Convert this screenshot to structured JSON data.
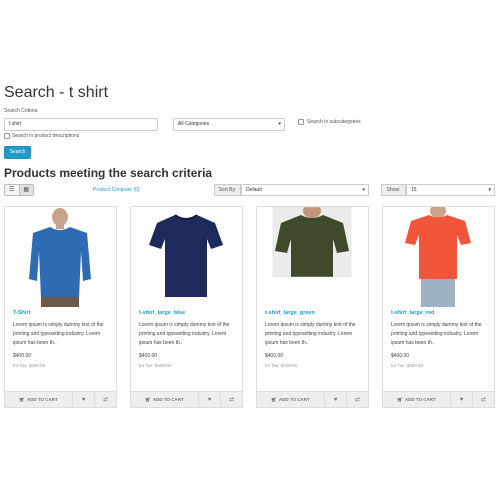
{
  "page": {
    "title": "Search - t shirt",
    "criteria_label": "Search Criteria"
  },
  "search": {
    "value": "t shirt",
    "category": "All Categories",
    "subcategories_label": "Search in subcategories",
    "descriptions_label": "Search in product descriptions",
    "button_label": "Search"
  },
  "results": {
    "heading": "Products meeting the search criteria",
    "compare_link": "Product Compare (0)",
    "sort_label": "Sort By:",
    "sort_value": "Default",
    "show_label": "Show:",
    "show_value": "15"
  },
  "products": [
    {
      "name": "T-Shirt",
      "description": "Lorem ipsum is simply dummy text of the printing and typesetting industry. Lorem ipsum has been th..",
      "price": "$400.00",
      "ex_tax": "Ex Tax: $400.00",
      "shirt_color": "#2f6bb3"
    },
    {
      "name": "t-shirt_large_blue",
      "description": "Lorem ipsum is simply dummy text of the printing and typesetting industry. Lorem ipsum has been th..",
      "price": "$400.00",
      "ex_tax": "Ex Tax: $400.00",
      "shirt_color": "#1f2a5c"
    },
    {
      "name": "t-shirt_large_green",
      "description": "Lorem ipsum is simply dummy text of the printing and typesetting industry. Lorem ipsum has been th..",
      "price": "$400.00",
      "ex_tax": "Ex Tax: $400.00",
      "shirt_color": "#3f4a2c"
    },
    {
      "name": "t-shirt_large_red",
      "description": "Lorem ipsum is simply dummy text of the printing and typesetting industry. Lorem ipsum has been th..",
      "price": "$400.00",
      "ex_tax": "Ex Tax: $400.00",
      "shirt_color": "#f2553a"
    }
  ],
  "card_actions": {
    "cart_label": "ADD TO CART",
    "cart_icon": "shopping-cart-icon",
    "wish_icon": "heart-icon",
    "compare_icon": "exchange-icon"
  },
  "colors": {
    "accent": "#229ac8"
  }
}
